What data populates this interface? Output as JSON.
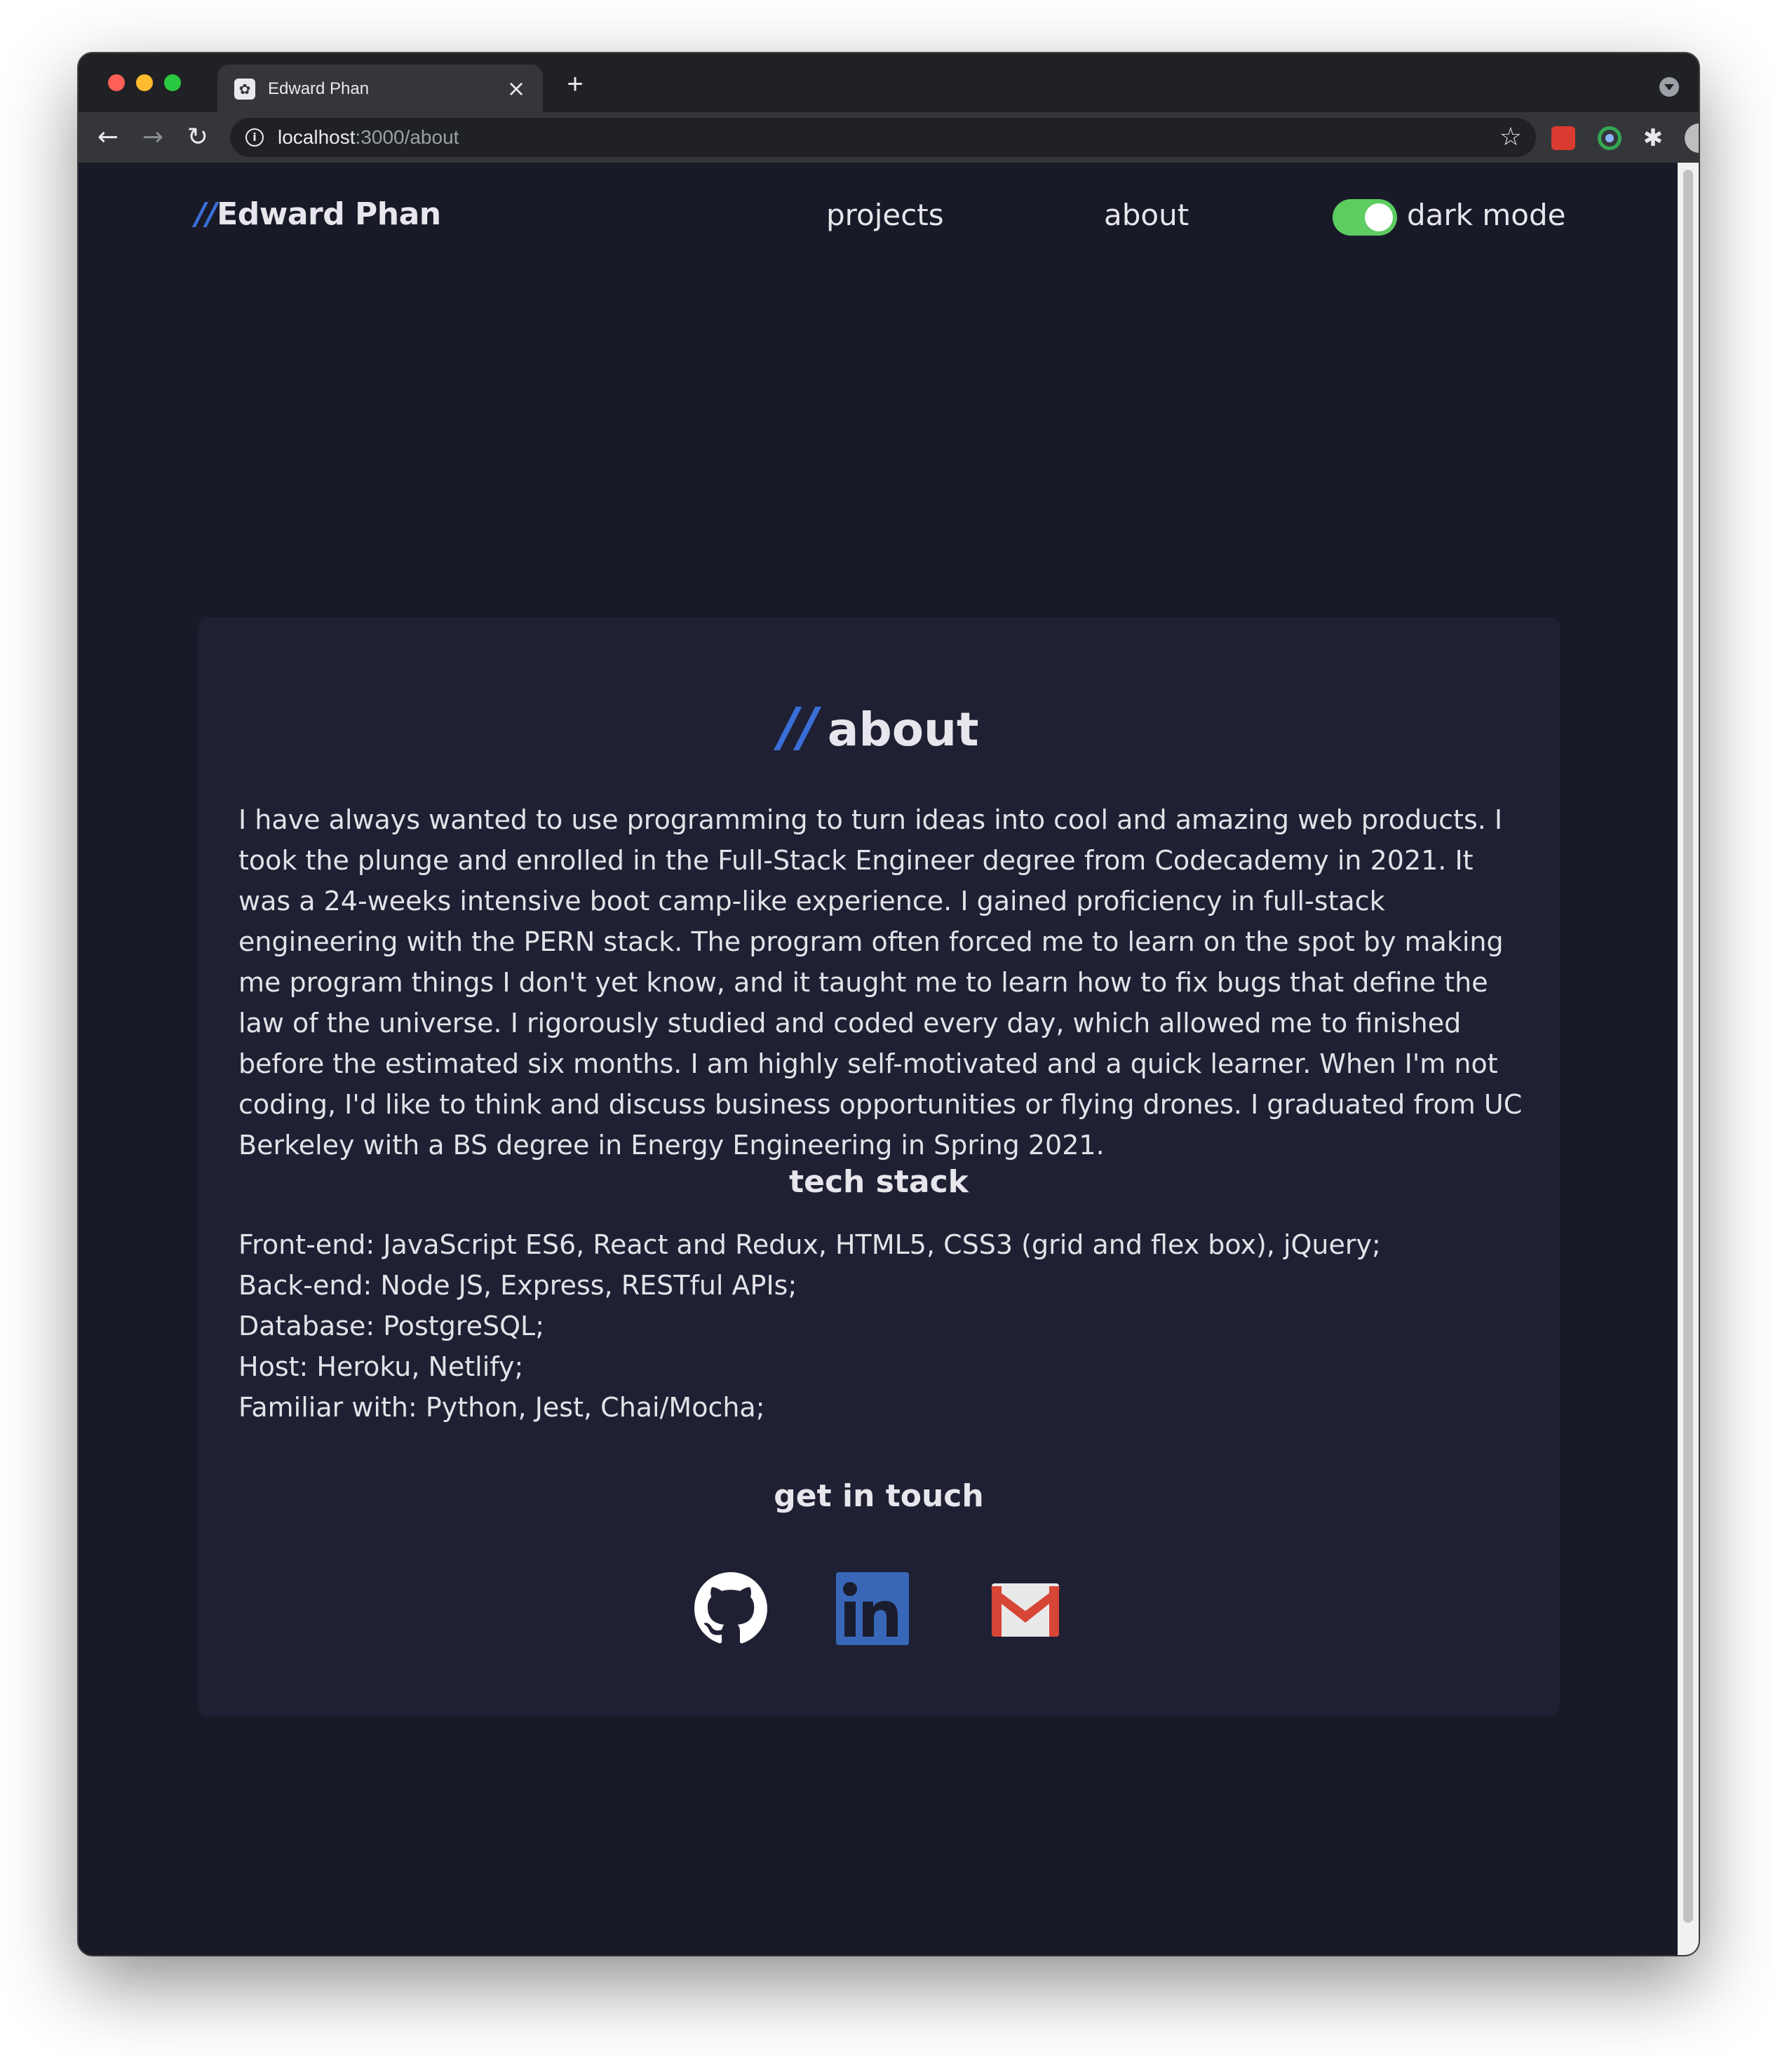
{
  "browser": {
    "tab_title": "Edward Phan",
    "url_host": "localhost",
    "url_path": ":3000/about",
    "icons": [
      "back-arrow-icon",
      "forward-arrow-icon",
      "reload-icon",
      "info-icon",
      "star-icon",
      "extensions-icon",
      "profile-avatar",
      "menu-dots-icon",
      "close-icon",
      "plus-icon"
    ]
  },
  "header": {
    "logo_slash": "//",
    "logo_text": "Edward Phan",
    "nav": {
      "projects": "projects",
      "about": "about"
    },
    "dark_mode_label": "dark mode",
    "dark_mode_on": true
  },
  "about": {
    "title_slash": "//",
    "title": "about",
    "bio": "I have always wanted to use programming to turn ideas into cool and amazing web products. I took the plunge and enrolled in the Full-Stack Engineer degree from Codecademy in 2021. It was a 24-weeks intensive boot camp-like experience. I gained proficiency in full-stack engineering with the PERN stack. The program often forced me to learn on the spot by making me program things I don't yet know, and it taught me to learn how to fix bugs that define the law of the universe. I rigorously studied and coded every day, which allowed me to finished before the estimated six months. I am highly self-motivated and a quick learner. When I'm not coding, I'd like to think and discuss business opportunities or flying drones. I graduated from UC Berkeley with a BS degree in Energy Engineering in Spring 2021.",
    "tech_stack_title": "tech stack",
    "tech_stack": [
      "Front-end: JavaScript ES6, React and Redux, HTML5, CSS3 (grid and flex box), jQuery;",
      "Back-end: Node JS, Express, RESTful APIs;",
      "Database: PostgreSQL;",
      "Host: Heroku, Netlify;",
      "Familiar with: Python, Jest, Chai/Mocha;"
    ],
    "contact_title": "get in touch",
    "contact_icons": [
      "github-icon",
      "linkedin-icon",
      "gmail-icon"
    ]
  },
  "colors": {
    "accent": "#3a6fd8",
    "background": "#191a28",
    "card": "#1f2033",
    "toggle": "#5dcc61"
  }
}
